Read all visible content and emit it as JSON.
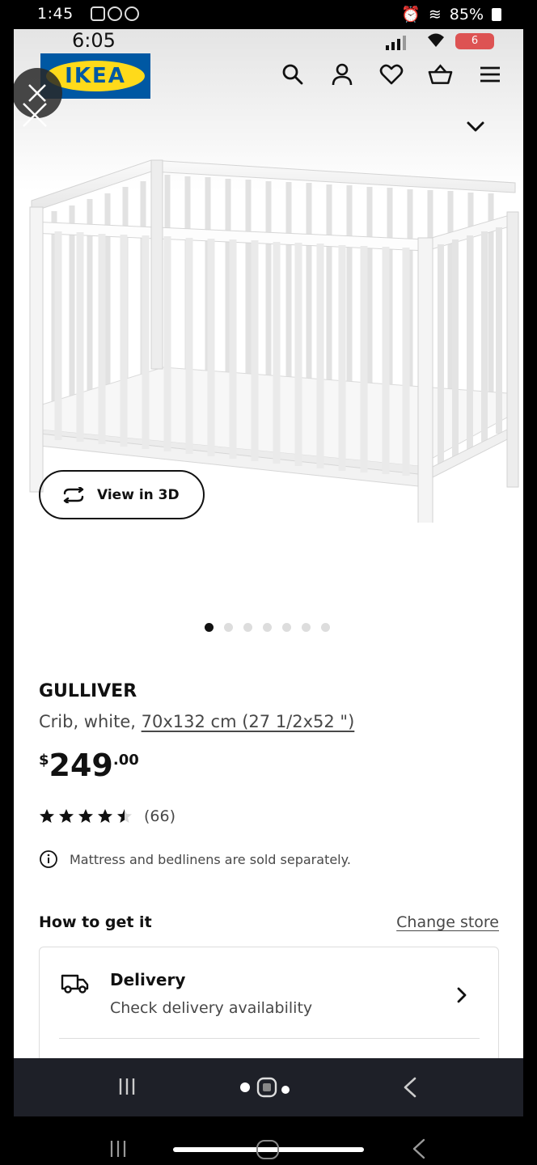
{
  "outer_status": {
    "time": "1:45",
    "battery": "85%"
  },
  "status_bar": {
    "time": "6:05",
    "battery": "6"
  },
  "header": {
    "logo_text": "IKEA",
    "icons": [
      "search-icon",
      "profile-icon",
      "heart-icon",
      "basket-icon",
      "menu-icon"
    ]
  },
  "gallery": {
    "view3d_label": "View in 3D",
    "image_count": 7,
    "active_index": 0
  },
  "product": {
    "name": "GULLIVER",
    "description_prefix": "Crib, white, ",
    "description_link": "70x132 cm (27 1/2x52 \")",
    "price_currency": "$",
    "price_int": "249",
    "price_dec": ".00",
    "rating_value": 4.5,
    "rating_max": 5,
    "review_count": "(66)",
    "notice": "Mattress and bedlinens are sold separately."
  },
  "availability": {
    "heading": "How to get it",
    "change_store": "Change store",
    "delivery_title": "Delivery",
    "delivery_subtitle": "Check delivery availability"
  },
  "colors": {
    "ikea_blue": "#0058a3",
    "ikea_yellow": "#ffda1a",
    "text_dark": "#111111",
    "text_muted": "#484848"
  }
}
